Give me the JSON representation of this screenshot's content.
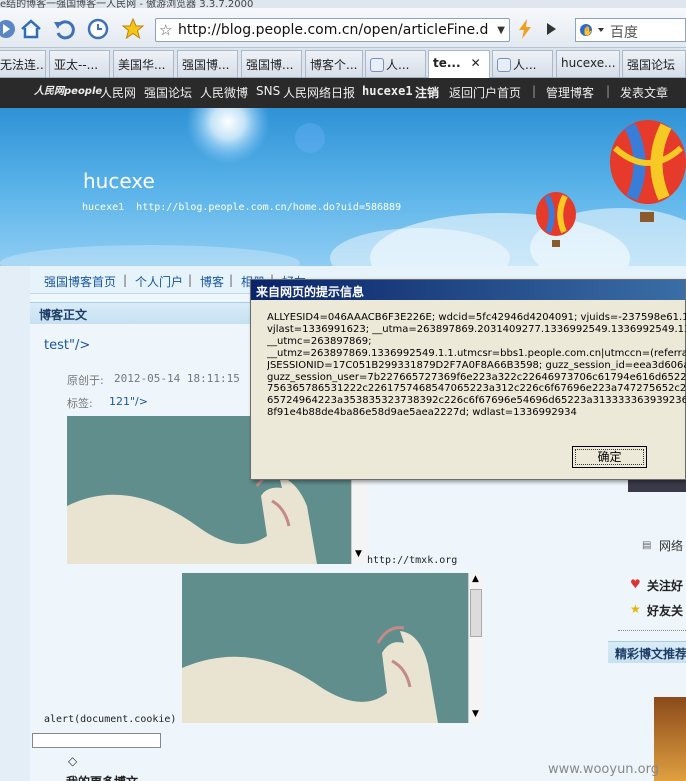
{
  "window": {
    "title": "e结的博客一强国博客一人民网 - 傲游浏览器 3.3.7.2000"
  },
  "toolbar": {
    "url": "http://blog.people.com.cn/open/articleFine.do?artic",
    "search_placeholder": "百度"
  },
  "tabs": [
    {
      "label": "无法连..."
    },
    {
      "label": "亚太--..."
    },
    {
      "label": "美国华..."
    },
    {
      "label": "强国博..."
    },
    {
      "label": "强国博..."
    },
    {
      "label": "博客个..."
    },
    {
      "label": "人..."
    },
    {
      "label": "te...",
      "active": true
    },
    {
      "label": "人..."
    },
    {
      "label": "hucexe..."
    },
    {
      "label": "强国论坛"
    }
  ],
  "sitenav": {
    "logo": "人民网people",
    "items": [
      "人民网",
      "强国论坛",
      "人民微博",
      "SNS",
      "人民网络日报"
    ],
    "user": "hucexe1",
    "logout": "注销",
    "back": "返回门户首页",
    "manage": "管理博客",
    "post": "发表文章"
  },
  "blog": {
    "title": "hucexe",
    "subtitle": "hucexe1  http://blog.people.com.cn/home.do?uid=586889"
  },
  "blognav": [
    "强国博客首页",
    "个人门户",
    "博客",
    "相册",
    "好友"
  ],
  "post": {
    "section": "博客正文",
    "title": "test\"/>",
    "created_label": "原创于:",
    "created_value": "2012-05-14 18:11:15",
    "tags_label": "标签:",
    "tags_value": "121\"/>",
    "link_text": "http://tmxk.org",
    "alert_text": "alert(document.cookie)",
    "diamond": "◇",
    "more": "我的更多博文"
  },
  "sidebar": {
    "network": "网络",
    "follow": "关注好",
    "friends": "好友关",
    "recommend": "精彩博文推荐"
  },
  "dialog": {
    "title": "来自网页的提示信息",
    "message": "ALLYESID4=046AAACB6F3E226E; wdcid=5fc42946d4204091; vjuids=-237598e61.137\nvjlast=1336991623; __utma=263897869.2031409277.1336992549.1336992549.1336\n__utmc=263897869;\n__utmz=263897869.1336992549.1.1.utmcsr=bbs1.people.com.cn|utmccn=(referral)|\nJSESSIONID=17C051B299331879D2F7A0F8A66B3598; guzz_session_id=eea3d606aac\nguzz_session_user=7b227665727369f6e223a322c22646973706c61794e616d65223a\n756365786531222c2261757468547065223a312c226c6f67696e223a747275652c227\n65724964223a353835323738392c226c6f67696e54696d65223a3133333639392363\n8f91e4b88de4ba86e58d9ae5aea2227d; wdlast=1336992934",
    "ok": "确定"
  },
  "watermark": "www.wooyun.org",
  "colors": {
    "accent": "#1a56a0",
    "dialog_title": "#0a246a",
    "sky": "#3a9ee0"
  }
}
